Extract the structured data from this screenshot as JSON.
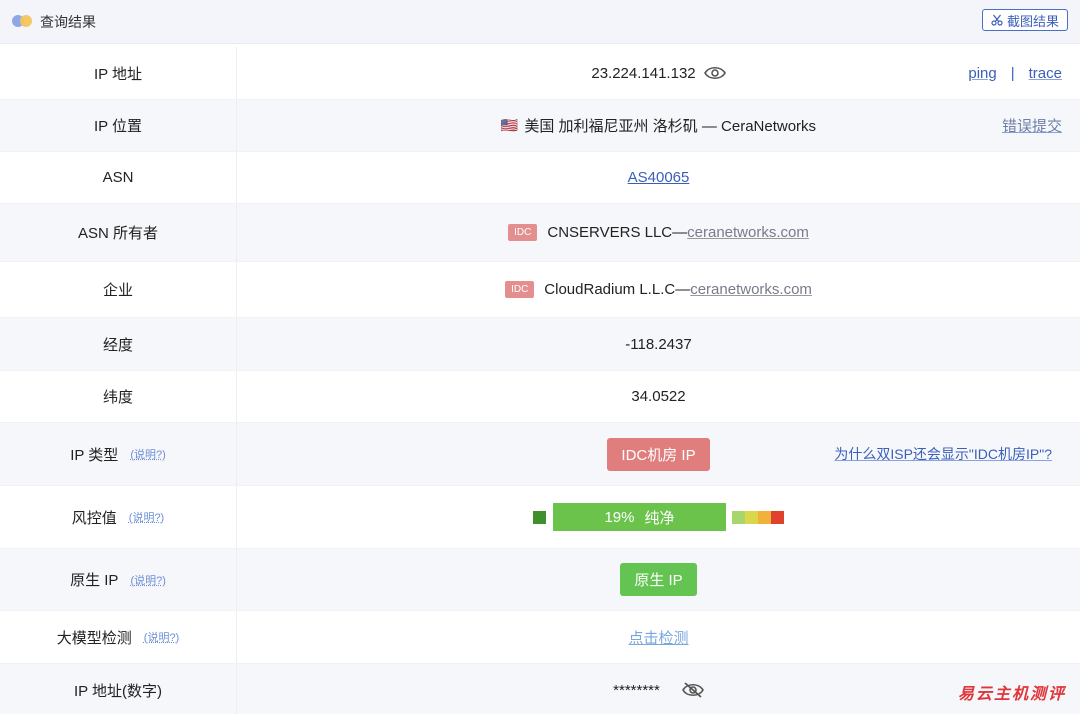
{
  "header": {
    "title": "查询结果",
    "screenshot_label": "截图结果"
  },
  "rows": {
    "ip": {
      "label": "IP 地址",
      "value": "23.224.141.132",
      "ping": "ping",
      "sep": "|",
      "trace": "trace"
    },
    "location": {
      "label": "IP 位置",
      "flag": "🇺🇸",
      "value": "美国 加利福尼亚州 洛杉矶 — CeraNetworks",
      "report": "错误提交"
    },
    "asn": {
      "label": "ASN",
      "value": "AS40065"
    },
    "asn_owner": {
      "label": "ASN 所有者",
      "tag": "IDC",
      "name": "CNSERVERS LLC—",
      "domain": "ceranetworks.com"
    },
    "company": {
      "label": "企业",
      "tag": "IDC",
      "name": "CloudRadium L.L.C—",
      "domain": "ceranetworks.com"
    },
    "longitude": {
      "label": "经度",
      "value": "-118.2437"
    },
    "latitude": {
      "label": "纬度",
      "value": "34.0522"
    },
    "ip_type": {
      "label": "IP 类型",
      "explain": "(说明?)",
      "value": "IDC机房 IP",
      "question": "为什么双ISP还会显示\"IDC机房IP\"?"
    },
    "risk": {
      "label": "风控值",
      "explain": "(说明?)",
      "percent": "19%",
      "status": "纯净"
    },
    "native": {
      "label": "原生 IP",
      "explain": "(说明?)",
      "value": "原生 IP"
    },
    "llm": {
      "label": "大模型检测",
      "explain": "(说明?)",
      "value": "点击检测"
    },
    "ip_number": {
      "label": "IP 地址(数字)",
      "value": "********"
    }
  },
  "colors": {
    "risk_square": "#3f8f2b",
    "risk_bar": "#6cc34c",
    "risk_scale": [
      "#a9d66b",
      "#d9d74b",
      "#f0b23a",
      "#e0412f"
    ]
  },
  "watermark": "易云主机测评"
}
